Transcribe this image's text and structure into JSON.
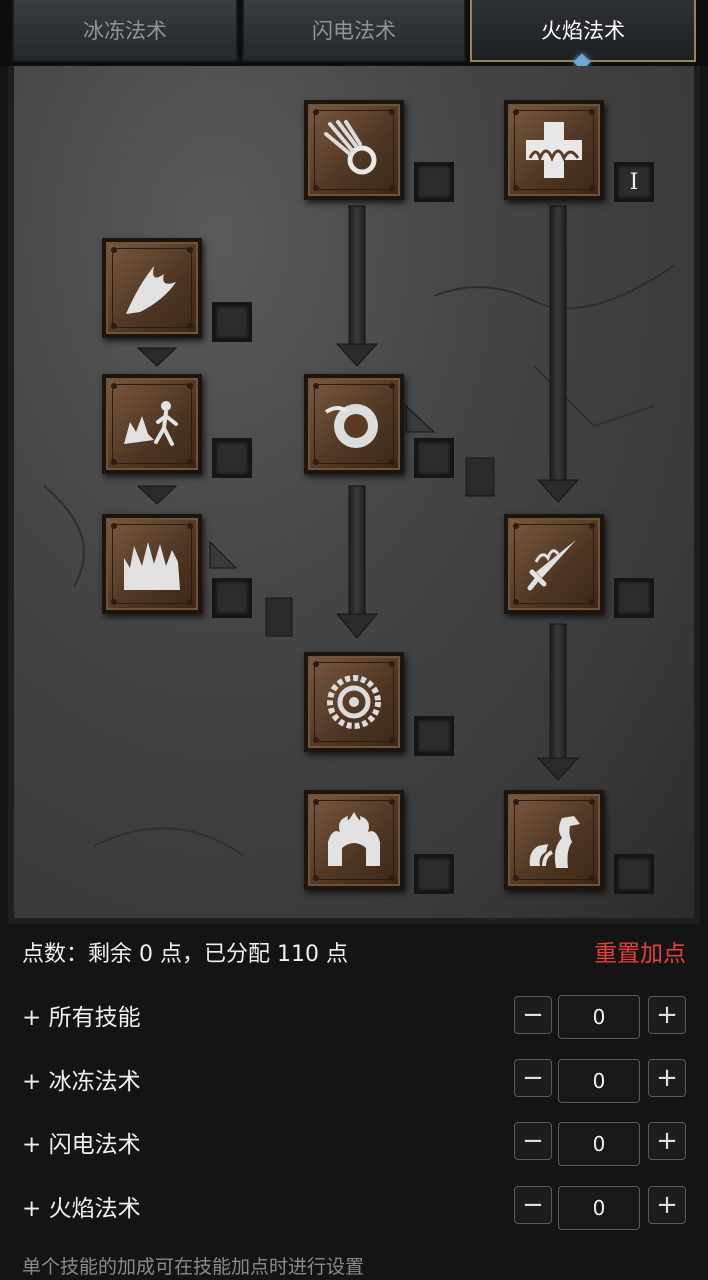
{
  "tabs": [
    {
      "label": "冰冻法术",
      "active": false
    },
    {
      "label": "闪电法术",
      "active": false
    },
    {
      "label": "火焰法术",
      "active": true
    }
  ],
  "skills": [
    {
      "name": "fire-bolt",
      "level": ""
    },
    {
      "name": "warmth",
      "level": "I"
    },
    {
      "name": "inferno",
      "level": ""
    },
    {
      "name": "blaze",
      "level": ""
    },
    {
      "name": "fire-ball",
      "level": ""
    },
    {
      "name": "fire-wall",
      "level": ""
    },
    {
      "name": "enchant",
      "level": ""
    },
    {
      "name": "meteor",
      "level": ""
    },
    {
      "name": "fire-mastery",
      "level": ""
    },
    {
      "name": "hydra",
      "level": ""
    }
  ],
  "summary": {
    "points_text": "点数：剩余 0 点，已分配 110 点",
    "reset_label": "重置加点"
  },
  "bonuses": [
    {
      "label": "+ 所有技能",
      "value": "0"
    },
    {
      "label": "+ 冰冻法术",
      "value": "0"
    },
    {
      "label": "+ 闪电法术",
      "value": "0"
    },
    {
      "label": "+ 火焰法术",
      "value": "0"
    }
  ],
  "stepper": {
    "minus": "−",
    "plus": "+"
  },
  "hint": "单个技能的加成可在技能加点时进行设置",
  "colors": {
    "accent_red": "#e5403c",
    "tab_active_border": "#9a8253",
    "indicator": "#6fa8d8"
  }
}
